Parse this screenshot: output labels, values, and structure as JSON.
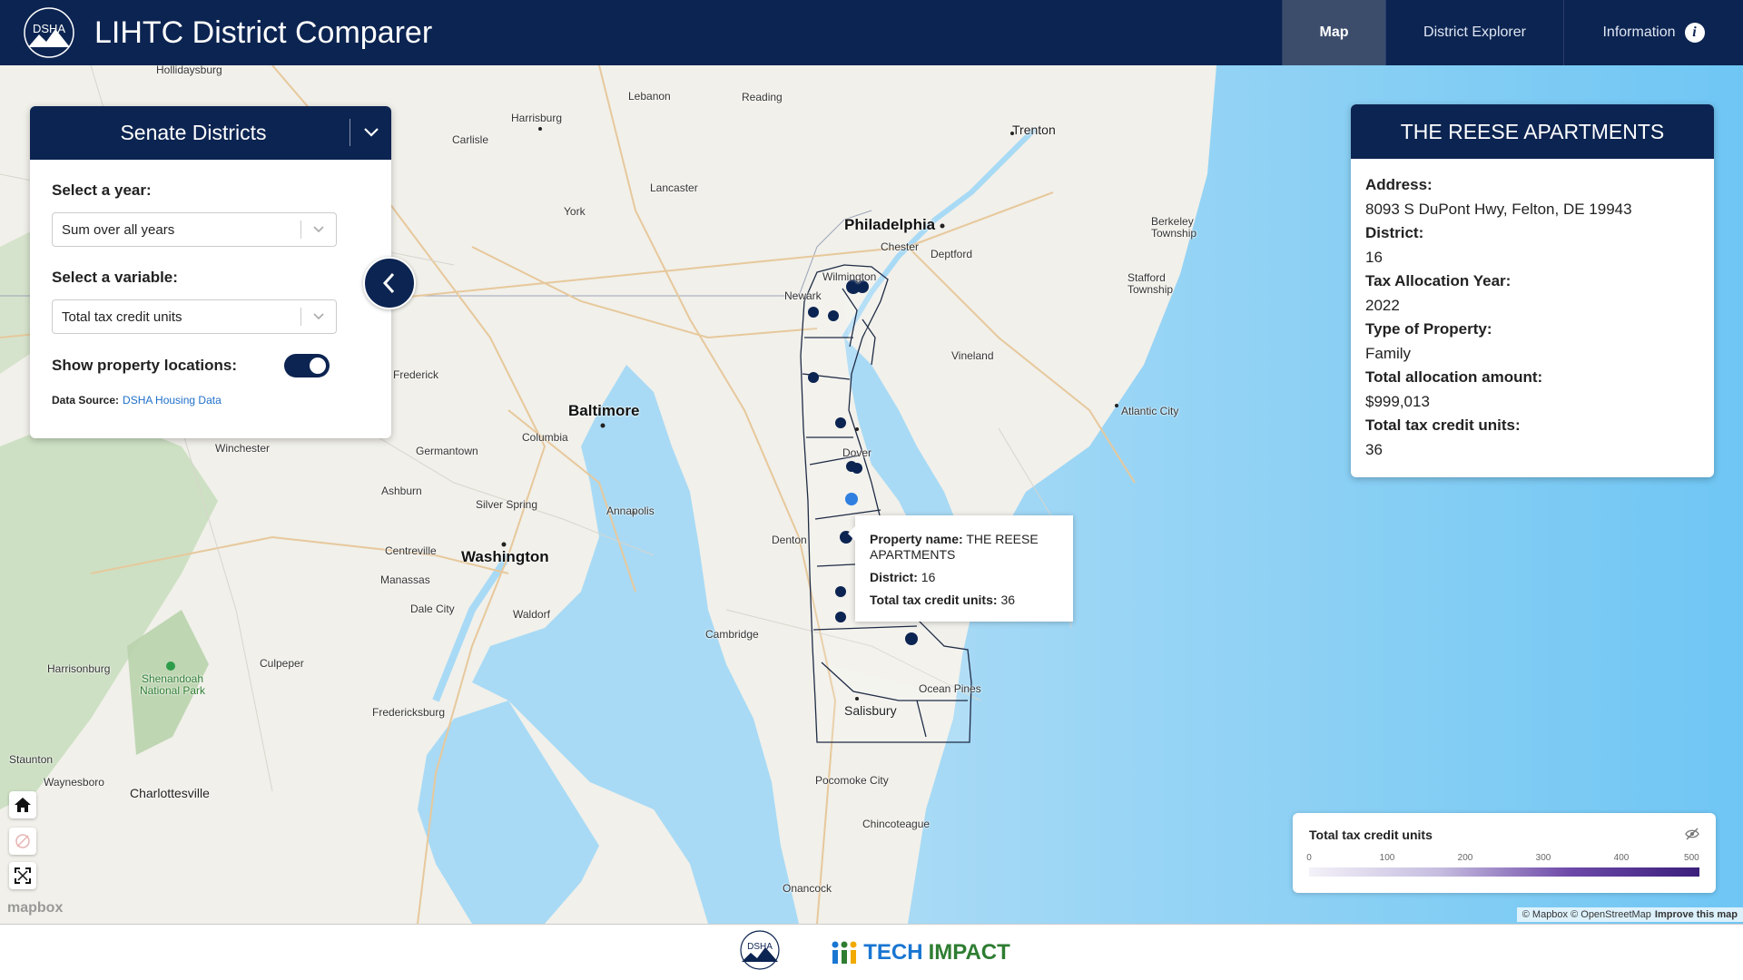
{
  "header": {
    "logo_text": "DSHA",
    "title": "LIHTC District Comparer",
    "nav": [
      {
        "label": "Map",
        "active": true
      },
      {
        "label": "District Explorer",
        "active": false
      },
      {
        "label": "Information",
        "active": false
      }
    ]
  },
  "panel": {
    "title": "Senate Districts",
    "year_label": "Select a year:",
    "year_value": "Sum over all years",
    "variable_label": "Select a variable:",
    "variable_value": "Total tax credit units",
    "locations_label": "Show property locations:",
    "locations_on": true,
    "source_label": "Data Source:",
    "source_link": "DSHA Housing Data"
  },
  "property": {
    "name": "THE REESE APARTMENTS",
    "fields": [
      {
        "label": "Address:",
        "value": "8093 S DuPont Hwy, Felton, DE 19943"
      },
      {
        "label": "District:",
        "value": "16"
      },
      {
        "label": "Tax Allocation Year:",
        "value": "2022"
      },
      {
        "label": "Type of Property:",
        "value": "Family"
      },
      {
        "label": "Total allocation amount:",
        "value": "$999,013"
      },
      {
        "label": "Total tax credit units:",
        "value": "36"
      }
    ]
  },
  "tooltip": {
    "name_label": "Property name:",
    "name_value": "THE REESE APARTMENTS",
    "district_label": "District:",
    "district_value": "16",
    "units_label": "Total tax credit units:",
    "units_value": "36"
  },
  "legend": {
    "title": "Total tax credit units",
    "ticks": [
      "0",
      "100",
      "200",
      "300",
      "400",
      "500"
    ]
  },
  "map": {
    "places": [
      {
        "name": "Hollidaysburg",
        "size": "small"
      },
      {
        "name": "Harrisburg",
        "size": "small"
      },
      {
        "name": "Lebanon",
        "size": "small"
      },
      {
        "name": "Reading",
        "size": "small"
      },
      {
        "name": "Trenton",
        "size": "med"
      },
      {
        "name": "Carlisle",
        "size": "small"
      },
      {
        "name": "Lancaster",
        "size": "small"
      },
      {
        "name": "York",
        "size": "small"
      },
      {
        "name": "Philadelphia",
        "size": "big"
      },
      {
        "name": "Chester",
        "size": "small"
      },
      {
        "name": "Deptford",
        "size": "small"
      },
      {
        "name": "Berkeley Township",
        "size": "small"
      },
      {
        "name": "Stafford Township",
        "size": "small"
      },
      {
        "name": "Newark",
        "size": "small"
      },
      {
        "name": "Wilmington",
        "size": "small"
      },
      {
        "name": "Vineland",
        "size": "small"
      },
      {
        "name": "Frederick",
        "size": "small"
      },
      {
        "name": "Baltimore",
        "size": "big"
      },
      {
        "name": "Columbia",
        "size": "small"
      },
      {
        "name": "Atlantic City",
        "size": "small"
      },
      {
        "name": "Winchester",
        "size": "small"
      },
      {
        "name": "Germantown",
        "size": "small"
      },
      {
        "name": "Dover",
        "size": "small"
      },
      {
        "name": "Ashburn",
        "size": "small"
      },
      {
        "name": "Silver Spring",
        "size": "small"
      },
      {
        "name": "Annapolis",
        "size": "small"
      },
      {
        "name": "Centreville",
        "size": "small"
      },
      {
        "name": "Washington",
        "size": "big"
      },
      {
        "name": "Denton",
        "size": "small"
      },
      {
        "name": "Manassas",
        "size": "small"
      },
      {
        "name": "Dale City",
        "size": "small"
      },
      {
        "name": "Waldorf",
        "size": "small"
      },
      {
        "name": "Cambridge",
        "size": "small"
      },
      {
        "name": "Harrisonburg",
        "size": "small"
      },
      {
        "name": "Culpeper",
        "size": "small"
      },
      {
        "name": "Shenandoah National Park",
        "size": "small"
      },
      {
        "name": "Ocean Pines",
        "size": "small"
      },
      {
        "name": "Fredericksburg",
        "size": "small"
      },
      {
        "name": "Salisbury",
        "size": "small"
      },
      {
        "name": "Staunton",
        "size": "small"
      },
      {
        "name": "Waynesboro",
        "size": "small"
      },
      {
        "name": "Charlottesville",
        "size": "small"
      },
      {
        "name": "Pocomoke City",
        "size": "small"
      },
      {
        "name": "Chincoteague",
        "size": "small"
      },
      {
        "name": "Onancock",
        "size": "small"
      }
    ],
    "logo": "mapbox",
    "attribution": "© Mapbox © OpenStreetMap",
    "attribution_link": "Improve this map"
  },
  "footer": {
    "logo_text": "DSHA",
    "partner_tech": "TECH",
    "partner_impact": "IMPACT"
  }
}
